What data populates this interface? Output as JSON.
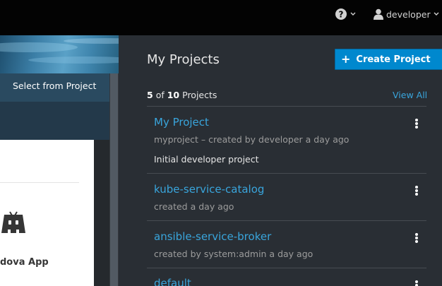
{
  "topnav": {
    "help_icon": "question-circle-icon",
    "user": {
      "icon": "user-icon",
      "name": "developer"
    }
  },
  "catalog": {
    "select_from_project": "Select from Project",
    "card": {
      "icon": "cordova-icon",
      "label": "dova App"
    }
  },
  "projects": {
    "title": "My Projects",
    "create_button": {
      "icon": "plus-icon",
      "label": "Create Project"
    },
    "count": {
      "shown": "5",
      "of_label": "of",
      "total": "10",
      "suffix": "Projects"
    },
    "view_all": "View All",
    "items": [
      {
        "name": "My Project",
        "meta": "myproject – created by developer a day ago",
        "description": "Initial developer project"
      },
      {
        "name": "kube-service-catalog",
        "meta": "created a day ago",
        "description": ""
      },
      {
        "name": "ansible-service-broker",
        "meta": "created by system:admin a day ago",
        "description": ""
      },
      {
        "name": "default",
        "meta": "",
        "description": ""
      }
    ]
  },
  "colors": {
    "accent": "#0088ce",
    "link": "#39a5dc",
    "nav_background": "#030303",
    "panel_background": "#292e34"
  }
}
